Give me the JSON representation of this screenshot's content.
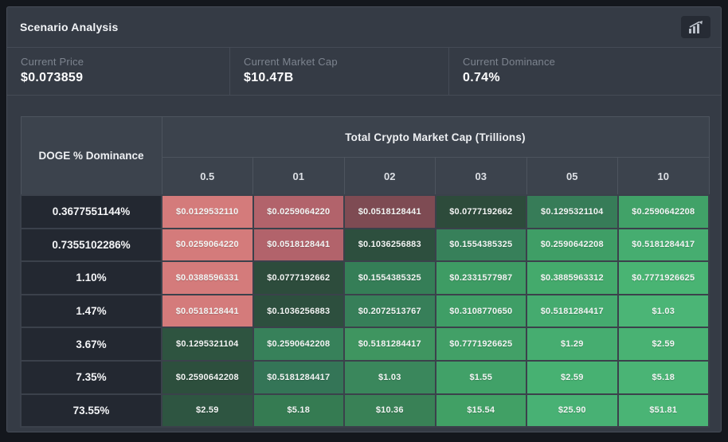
{
  "panel": {
    "title": "Scenario Analysis",
    "icon": "trend-chart-icon"
  },
  "stats": [
    {
      "label": "Current Price",
      "value": "$0.073859"
    },
    {
      "label": "Current Market Cap",
      "value": "$10.47B"
    },
    {
      "label": "Current Dominance",
      "value": "0.74%"
    }
  ],
  "table": {
    "row_header_title": "DOGE % Dominance",
    "col_group_title": "Total Crypto Market Cap (Trillions)",
    "columns": [
      "0.5",
      "01",
      "02",
      "03",
      "05",
      "10"
    ],
    "rows": [
      {
        "dominance": "0.3677551144%",
        "cells": [
          {
            "value": "$0.0129532110",
            "color": "#d47b7b"
          },
          {
            "value": "$0.0259064220",
            "color": "#b2636b"
          },
          {
            "value": "$0.0518128441",
            "color": "#7e4b53"
          },
          {
            "value": "$0.0777192662",
            "color": "#2d4b3b"
          },
          {
            "value": "$0.1295321104",
            "color": "#377c58"
          },
          {
            "value": "$0.2590642208",
            "color": "#41a268"
          }
        ]
      },
      {
        "dominance": "0.7355102286%",
        "cells": [
          {
            "value": "$0.0259064220",
            "color": "#d47b7b"
          },
          {
            "value": "$0.0518128441",
            "color": "#b2636b"
          },
          {
            "value": "$0.1036256883",
            "color": "#2d4f3e"
          },
          {
            "value": "$0.1554385325",
            "color": "#37805a"
          },
          {
            "value": "$0.2590642208",
            "color": "#3f9e66"
          },
          {
            "value": "$0.5181284417",
            "color": "#46ad70"
          }
        ]
      },
      {
        "dominance": "1.10%",
        "cells": [
          {
            "value": "$0.0388596331",
            "color": "#d47b7b"
          },
          {
            "value": "$0.0777192662",
            "color": "#2d4c3c"
          },
          {
            "value": "$0.1554385325",
            "color": "#357e57"
          },
          {
            "value": "$0.2331577987",
            "color": "#3e9c64"
          },
          {
            "value": "$0.3885963312",
            "color": "#44aa6c"
          },
          {
            "value": "$0.7771926625",
            "color": "#49b473"
          }
        ]
      },
      {
        "dominance": "1.47%",
        "cells": [
          {
            "value": "$0.0518128441",
            "color": "#d47b7b"
          },
          {
            "value": "$0.1036256883",
            "color": "#2d4f3e"
          },
          {
            "value": "$0.2072513767",
            "color": "#377f59"
          },
          {
            "value": "$0.3108770650",
            "color": "#3f9e66"
          },
          {
            "value": "$0.5181284417",
            "color": "#45ab6f"
          },
          {
            "value": "$1.03",
            "color": "#4bb576"
          }
        ]
      },
      {
        "dominance": "3.67%",
        "cells": [
          {
            "value": "$0.1295321104",
            "color": "#2e5440"
          },
          {
            "value": "$0.2590642208",
            "color": "#37815a"
          },
          {
            "value": "$0.5181284417",
            "color": "#3f9560"
          },
          {
            "value": "$0.7771926625",
            "color": "#42a067"
          },
          {
            "value": "$1.29",
            "color": "#46ad70"
          },
          {
            "value": "$2.59",
            "color": "#49b273"
          }
        ]
      },
      {
        "dominance": "7.35%",
        "cells": [
          {
            "value": "$0.2590642208",
            "color": "#2d4f3d"
          },
          {
            "value": "$0.5181284417",
            "color": "#347557"
          },
          {
            "value": "$1.03",
            "color": "#3a875c"
          },
          {
            "value": "$1.55",
            "color": "#41a168"
          },
          {
            "value": "$2.59",
            "color": "#47b172"
          },
          {
            "value": "$5.18",
            "color": "#4ab475"
          }
        ]
      },
      {
        "dominance": "73.55%",
        "cells": [
          {
            "value": "$2.59",
            "color": "#2e5541"
          },
          {
            "value": "$5.18",
            "color": "#357b52"
          },
          {
            "value": "$10.36",
            "color": "#398156"
          },
          {
            "value": "$15.54",
            "color": "#41a065"
          },
          {
            "value": "$25.90",
            "color": "#48b174"
          },
          {
            "value": "$51.81",
            "color": "#4ab475"
          }
        ]
      }
    ]
  },
  "colors": {
    "page_bg": "#14171d",
    "panel_bg": "#353b45",
    "header_bg": "#3c434d",
    "row_header_bg": "#232831",
    "loss_strong": "#d47b7b",
    "loss_mid": "#b2636b",
    "loss_near": "#7e4b53",
    "gain_dark": "#2d4b3b",
    "gain_bright": "#4bb576"
  }
}
